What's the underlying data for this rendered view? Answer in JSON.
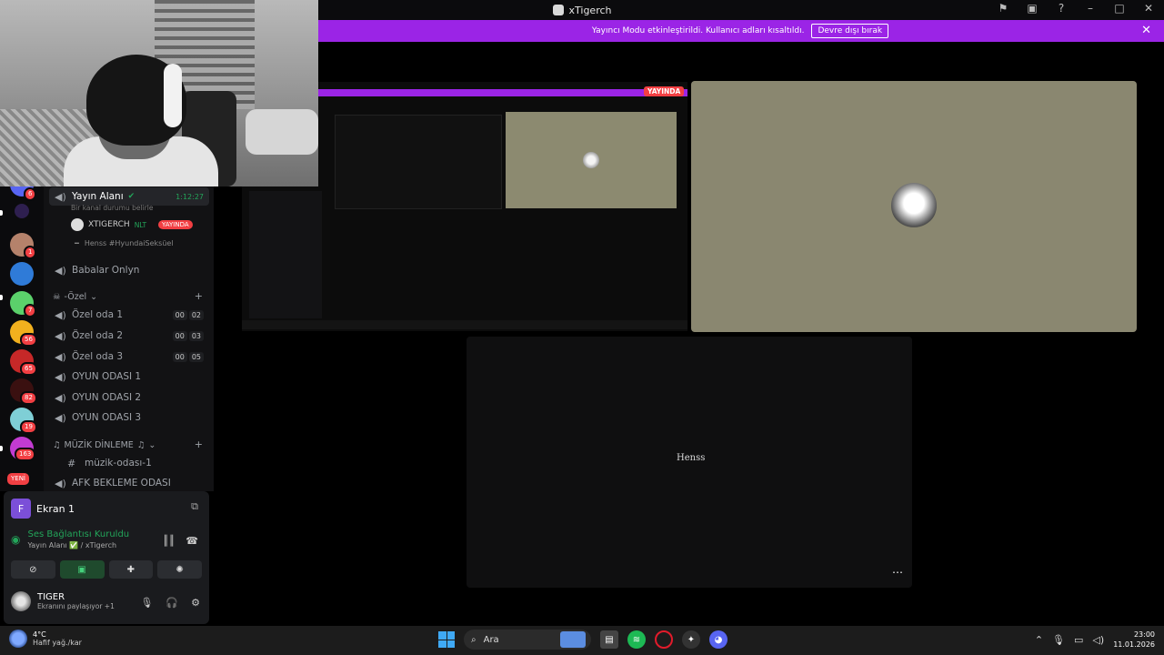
{
  "window": {
    "title": "xTigerch"
  },
  "banner": {
    "message": "Yayıncı Modu etkinleştirildi. Kullanıcı adları kısaltıldı.",
    "button": "Devre dışı bırak"
  },
  "servers": {
    "badges": [
      "6",
      "1",
      "7",
      "56",
      "65",
      "82",
      "19",
      "163"
    ],
    "new_label": "YENİ"
  },
  "channels": {
    "active": {
      "name": "Yayın Alanı",
      "timer": "1:12:27",
      "status_hint": "Bir kanal durumu belirle"
    },
    "members": [
      {
        "name": "XTIGERCH",
        "tag": "NLT",
        "live": "YAYINDA"
      },
      {
        "name": "Henss #HyundaiSeksüel"
      }
    ],
    "list": [
      {
        "name": "Babalar Onlyn"
      },
      {
        "name": "Özel oda 1",
        "c1": "00",
        "c2": "02"
      },
      {
        "name": "Özel oda 2",
        "c1": "00",
        "c2": "03"
      },
      {
        "name": "Özel oda 3",
        "c1": "00",
        "c2": "05"
      },
      {
        "name": "OYUN ODASI 1"
      },
      {
        "name": "OYUN ODASI 2"
      },
      {
        "name": "OYUN ODASI 3"
      },
      {
        "name": "müzik-odası-1"
      },
      {
        "name": "AFK BEKLEME ODASI"
      }
    ],
    "category_ozel": "-Özel",
    "category_muzik": "MÜZİK DİNLEME"
  },
  "panel": {
    "screen_share": "Ekran 1",
    "voice_status": "Ses Bağlantısı Kuruldu",
    "voice_channel": "Yayın Alanı ✅ / xTigerch",
    "user_name": "TIGER",
    "user_status": "Ekranını paylaşıyor +1"
  },
  "stream": {
    "live_badge": "YAYINDA",
    "user_tile_label": "Henss"
  },
  "taskbar": {
    "temp": "4°C",
    "weather": "Hafif yağ./kar",
    "search": "Ara",
    "time": "23:00",
    "date": "11.01.2026"
  },
  "colors": {
    "banner": "#9b24e6",
    "online_green": "#23a55a",
    "live_red": "#f23f43"
  }
}
